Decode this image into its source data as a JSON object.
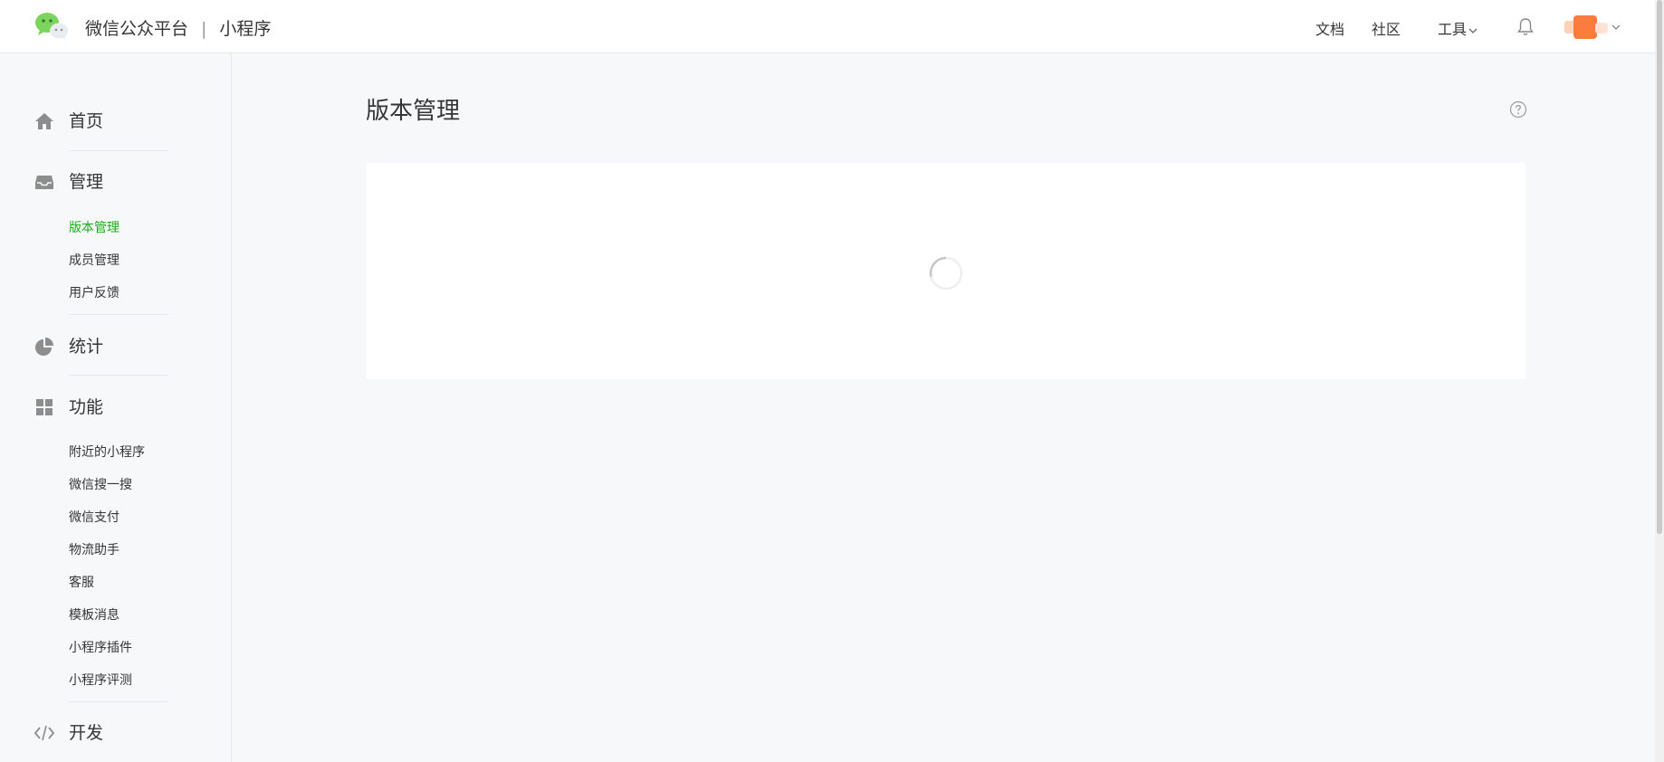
{
  "header": {
    "brand_title": "微信公众平台",
    "brand_separator": "|",
    "brand_sub": "小程序",
    "nav": {
      "docs": "文档",
      "community": "社区",
      "tools": "工具"
    },
    "icons": [
      "wechat-logo-icon",
      "chevron-down-icon",
      "bell-icon",
      "avatar",
      "chevron-down-icon"
    ]
  },
  "sidebar": {
    "home": "首页",
    "manage": {
      "label": "管理",
      "items": [
        "版本管理",
        "成员管理",
        "用户反馈"
      ],
      "active": "版本管理"
    },
    "stats": "统计",
    "features": {
      "label": "功能",
      "items": [
        "附近的小程序",
        "微信搜一搜",
        "微信支付",
        "物流助手",
        "客服",
        "模板消息",
        "小程序插件",
        "小程序评测"
      ]
    },
    "develop": "开发"
  },
  "main": {
    "title": "版本管理",
    "loading": true
  },
  "colors": {
    "accent": "#1aad19",
    "background": "#f6f8f9",
    "text": "#353535"
  }
}
